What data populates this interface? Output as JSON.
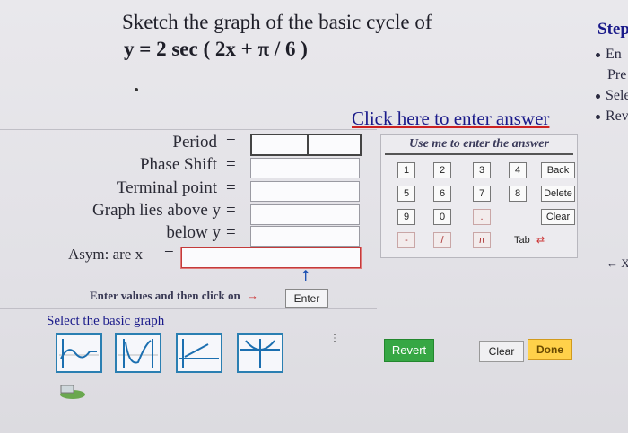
{
  "problem": {
    "line1": "Sketch the graph of the basic cycle of",
    "line2": "y  =  2 sec ( 2x + π / 6 )"
  },
  "form": {
    "period_label": "Period",
    "phase_shift_label": "Phase Shift",
    "terminal_point_label": "Terminal point",
    "graph_lies_above_label": "Graph lies above y",
    "below_label": "below y",
    "asym_label": "Asym: are x",
    "equals": "="
  },
  "link": {
    "click_here": "Click here to enter answer"
  },
  "keypad": {
    "title": "Use me to enter the answer",
    "row1": [
      "1",
      "2",
      "3",
      "4"
    ],
    "row2": [
      "5",
      "6",
      "7",
      "8"
    ],
    "row3": [
      "9",
      "0",
      "."
    ],
    "row4": [
      "-",
      "/",
      "π"
    ],
    "back": "Back",
    "delete": "Delete",
    "clear": "Clear",
    "tab": "Tab"
  },
  "enter_row": {
    "instruction": "Enter values and then click on",
    "arrow": "→",
    "up_arrow": "↑",
    "enter_label": "Enter"
  },
  "graph_select": {
    "label": "Select the basic graph"
  },
  "actions": {
    "revert": "Revert",
    "clear": "Clear",
    "done": "Done"
  },
  "sidebar": {
    "heading": "Step",
    "item1": "En",
    "item1b": "Pre",
    "item2": "Sele",
    "item3": "Rev",
    "bottom_label": "← X"
  }
}
